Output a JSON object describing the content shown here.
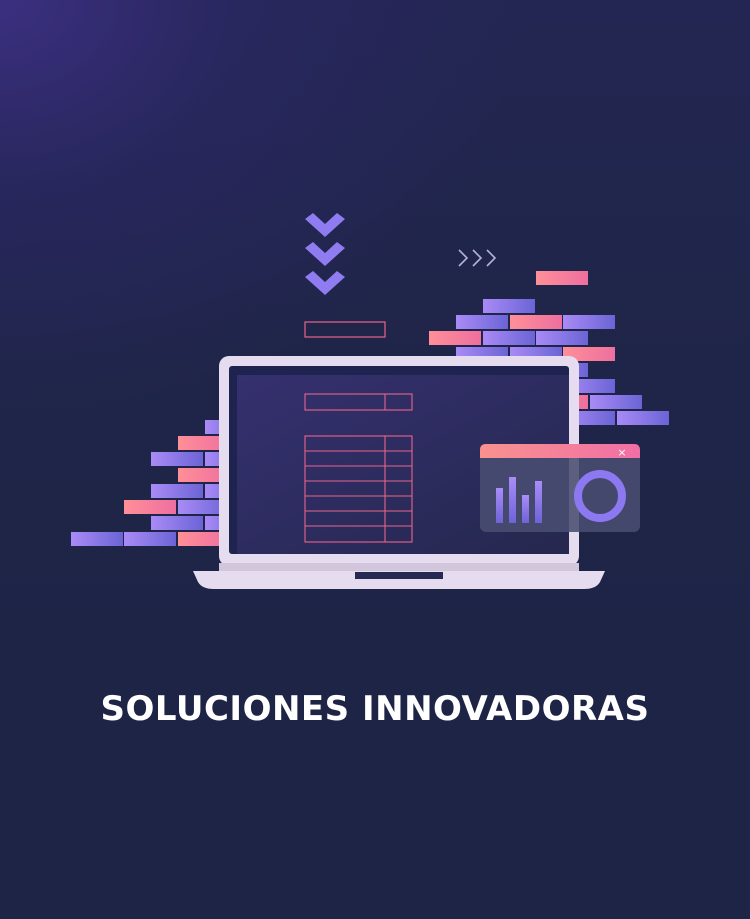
{
  "headline": "SOLUCIONES INNOVADORAS",
  "popup": {
    "close_glyph": "×",
    "bar_levels": [
      0.5,
      0.65,
      0.4,
      0.6
    ]
  },
  "icons": {
    "down_arrows": "chevron-down-icon",
    "right_arrows": "chevron-right-icon",
    "close": "close-icon",
    "ring_chart": "ring-icon"
  },
  "colors": {
    "background_top": "#332d7a",
    "background": "#1e2546",
    "brick_purple": "#8f7af0",
    "brick_pink": "#f77f9c",
    "laptop_body": "#e6dcef",
    "screen": "#2b2f68",
    "wireframe": "#e8648a",
    "text": "#ffffff"
  }
}
